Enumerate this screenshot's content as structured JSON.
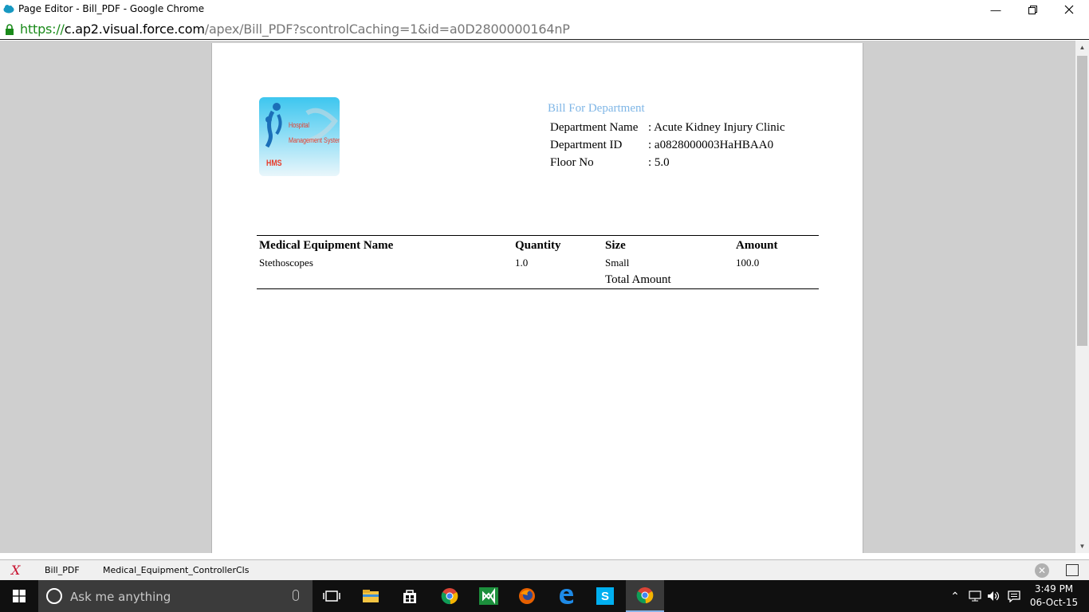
{
  "window": {
    "title": "Page Editor - Bill_PDF - Google Chrome",
    "minimize_icon": "minimize-icon",
    "restore_icon": "restore-icon",
    "close_icon": "close-icon"
  },
  "address": {
    "scheme": "https://",
    "host": "c.ap2.visual.force.com",
    "path": "/apex/Bill_PDF?scontrolCaching=1&id=a0D2800000164nP"
  },
  "document": {
    "logo": {
      "line1": "Hospital",
      "line2": "Management System",
      "abbr": "HMS"
    },
    "bill_title": "Bill For Department",
    "fields": [
      {
        "label": "Department Name",
        "value": ": Acute Kidney Injury Clinic"
      },
      {
        "label": "Department ID",
        "value": ": a0828000003HaHBAA0"
      },
      {
        "label": "Floor No",
        "value": ": 5.0"
      }
    ],
    "table": {
      "headers": [
        "Medical Equipment Name",
        "Quantity",
        "Size",
        "Amount"
      ],
      "rows": [
        [
          "Stethoscopes",
          "1.0",
          "Small",
          "100.0"
        ]
      ],
      "total_label": "Total Amount"
    }
  },
  "devbar": {
    "tabs": [
      "Bill_PDF",
      "Medical_Equipment_ControllerCls"
    ]
  },
  "taskbar": {
    "search_placeholder": "Ask me anything",
    "time": "3:49 PM",
    "date": "06-Oct-15"
  },
  "colors": {
    "accent_title": "#7fb6e6",
    "url_scheme": "#1a8a1a",
    "taskbar_bg": "#101010"
  }
}
